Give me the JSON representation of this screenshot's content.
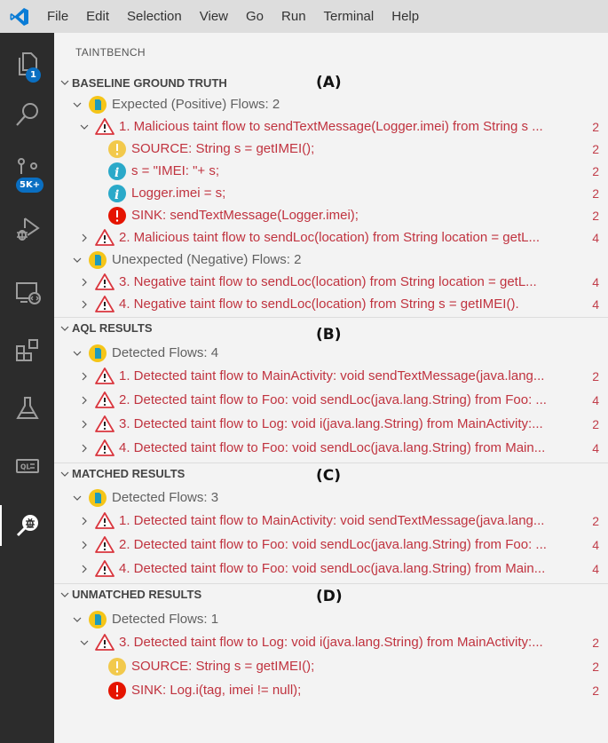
{
  "menubar": {
    "app_icon": "vscode-logo-icon",
    "items": [
      "File",
      "Edit",
      "Selection",
      "View",
      "Go",
      "Run",
      "Terminal",
      "Help"
    ]
  },
  "activitybar": {
    "items": [
      {
        "icon": "files-icon",
        "badge": "1"
      },
      {
        "icon": "search-icon",
        "badge": null
      },
      {
        "icon": "source-control-icon",
        "badge": "5K+"
      },
      {
        "icon": "run-debug-icon",
        "badge": null
      },
      {
        "icon": "remote-explorer-icon",
        "badge": null
      },
      {
        "icon": "extensions-icon",
        "badge": null
      },
      {
        "icon": "testing-icon",
        "badge": null
      },
      {
        "icon": "ql-icon",
        "badge": null
      },
      {
        "icon": "taintbench-bug-search-icon",
        "badge": null,
        "active": true
      }
    ]
  },
  "sidebar": {
    "title": "TAINTBENCH",
    "sections": [
      {
        "title": "BASELINE GROUND TRUTH",
        "label": "(A)",
        "groups": [
          {
            "label": "Expected (Positive) Flows: 2",
            "flows": [
              {
                "label": "1. Malicious taint flow to sendTextMessage(Logger.imei) from String s ...",
                "count": "2",
                "expanded": true,
                "steps": [
                  {
                    "kind": "source",
                    "label": "SOURCE: String s = getIMEI();",
                    "count": "2"
                  },
                  {
                    "kind": "info",
                    "label": "s = \"IMEI: \"+ s;",
                    "count": "2"
                  },
                  {
                    "kind": "info",
                    "label": "Logger.imei = s;",
                    "count": "2"
                  },
                  {
                    "kind": "sink",
                    "label": "SINK: sendTextMessage(Logger.imei);",
                    "count": "2"
                  }
                ]
              },
              {
                "label": "2. Malicious taint flow to sendLoc(location) from String location = getL...",
                "count": "4",
                "expanded": false
              }
            ]
          },
          {
            "label": "Unexpected (Negative) Flows: 2",
            "flows": [
              {
                "label": "3. Negative taint flow to sendLoc(location) from String location = getL...",
                "count": "4",
                "expanded": false
              },
              {
                "label": "4. Negative taint flow to sendLoc(location) from String s = getIMEI().",
                "count": "4",
                "expanded": false
              }
            ]
          }
        ]
      },
      {
        "title": "AQL RESULTS",
        "label": "(B)",
        "groups": [
          {
            "label": "Detected Flows: 4",
            "flows": [
              {
                "label": "1. Detected taint flow to MainActivity: void sendTextMessage(java.lang...",
                "count": "2"
              },
              {
                "label": "2. Detected taint flow to Foo: void sendLoc(java.lang.String) from Foo: ...",
                "count": "4"
              },
              {
                "label": "3. Detected taint flow to Log: void i(java.lang.String) from MainActivity:...",
                "count": "2"
              },
              {
                "label": "4. Detected taint flow to Foo: void sendLoc(java.lang.String) from Main...",
                "count": "4"
              }
            ]
          }
        ]
      },
      {
        "title": "MATCHED RESULTS",
        "label": "(C)",
        "groups": [
          {
            "label": "Detected Flows: 3",
            "flows": [
              {
                "label": "1. Detected taint flow to MainActivity: void sendTextMessage(java.lang...",
                "count": "2"
              },
              {
                "label": "2. Detected taint flow to Foo: void sendLoc(java.lang.String) from Foo: ...",
                "count": "4"
              },
              {
                "label": "4. Detected taint flow to Foo: void sendLoc(java.lang.String) from Main...",
                "count": "4"
              }
            ]
          }
        ]
      },
      {
        "title": "UNMATCHED RESULTS",
        "label": "(D)",
        "groups": [
          {
            "label": "Detected Flows: 1",
            "flows": [
              {
                "label": "3. Detected taint flow to Log: void i(java.lang.String) from MainActivity:...",
                "count": "2",
                "expanded": true,
                "steps": [
                  {
                    "kind": "source",
                    "label": "SOURCE: String s = getIMEI();",
                    "count": "2"
                  },
                  {
                    "kind": "sink",
                    "label": "SINK: Log.i(tag, imei != null);",
                    "count": "2"
                  }
                ]
              }
            ]
          }
        ]
      }
    ]
  },
  "colors": {
    "flow_text": "#c0333f",
    "warning_triangle": "#d9363e",
    "source_circle": "#f2c94c",
    "info_circle": "#2aa9c9",
    "sink_circle": "#e51400",
    "badge": "#0a6fc2",
    "activitybar_bg": "#2c2c2c",
    "sidebar_bg": "#f3f3f3"
  }
}
